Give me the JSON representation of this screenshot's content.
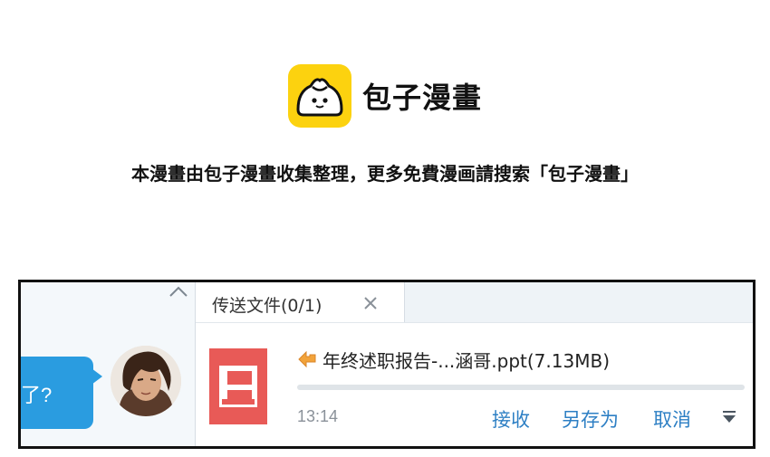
{
  "brand": {
    "name": "包子漫畫"
  },
  "notice": {
    "text": "本漫畫由包子漫畫收集整理，更多免費漫画請搜索「包子漫畫」"
  },
  "chat": {
    "bubble_text": "了?",
    "tab": {
      "label": "传送文件(0/1)"
    },
    "file": {
      "name": "年终述职报告-...涵哥.ppt(7.13MB)",
      "time": "13:14",
      "progress": 0
    },
    "actions": {
      "receive": "接收",
      "save_as": "另存为",
      "cancel": "取消"
    }
  },
  "colors": {
    "logo_bg": "#fcd20f",
    "bubble": "#2a9ce0",
    "ppt_icon": "#e85a57",
    "link": "#2d7fc4"
  }
}
